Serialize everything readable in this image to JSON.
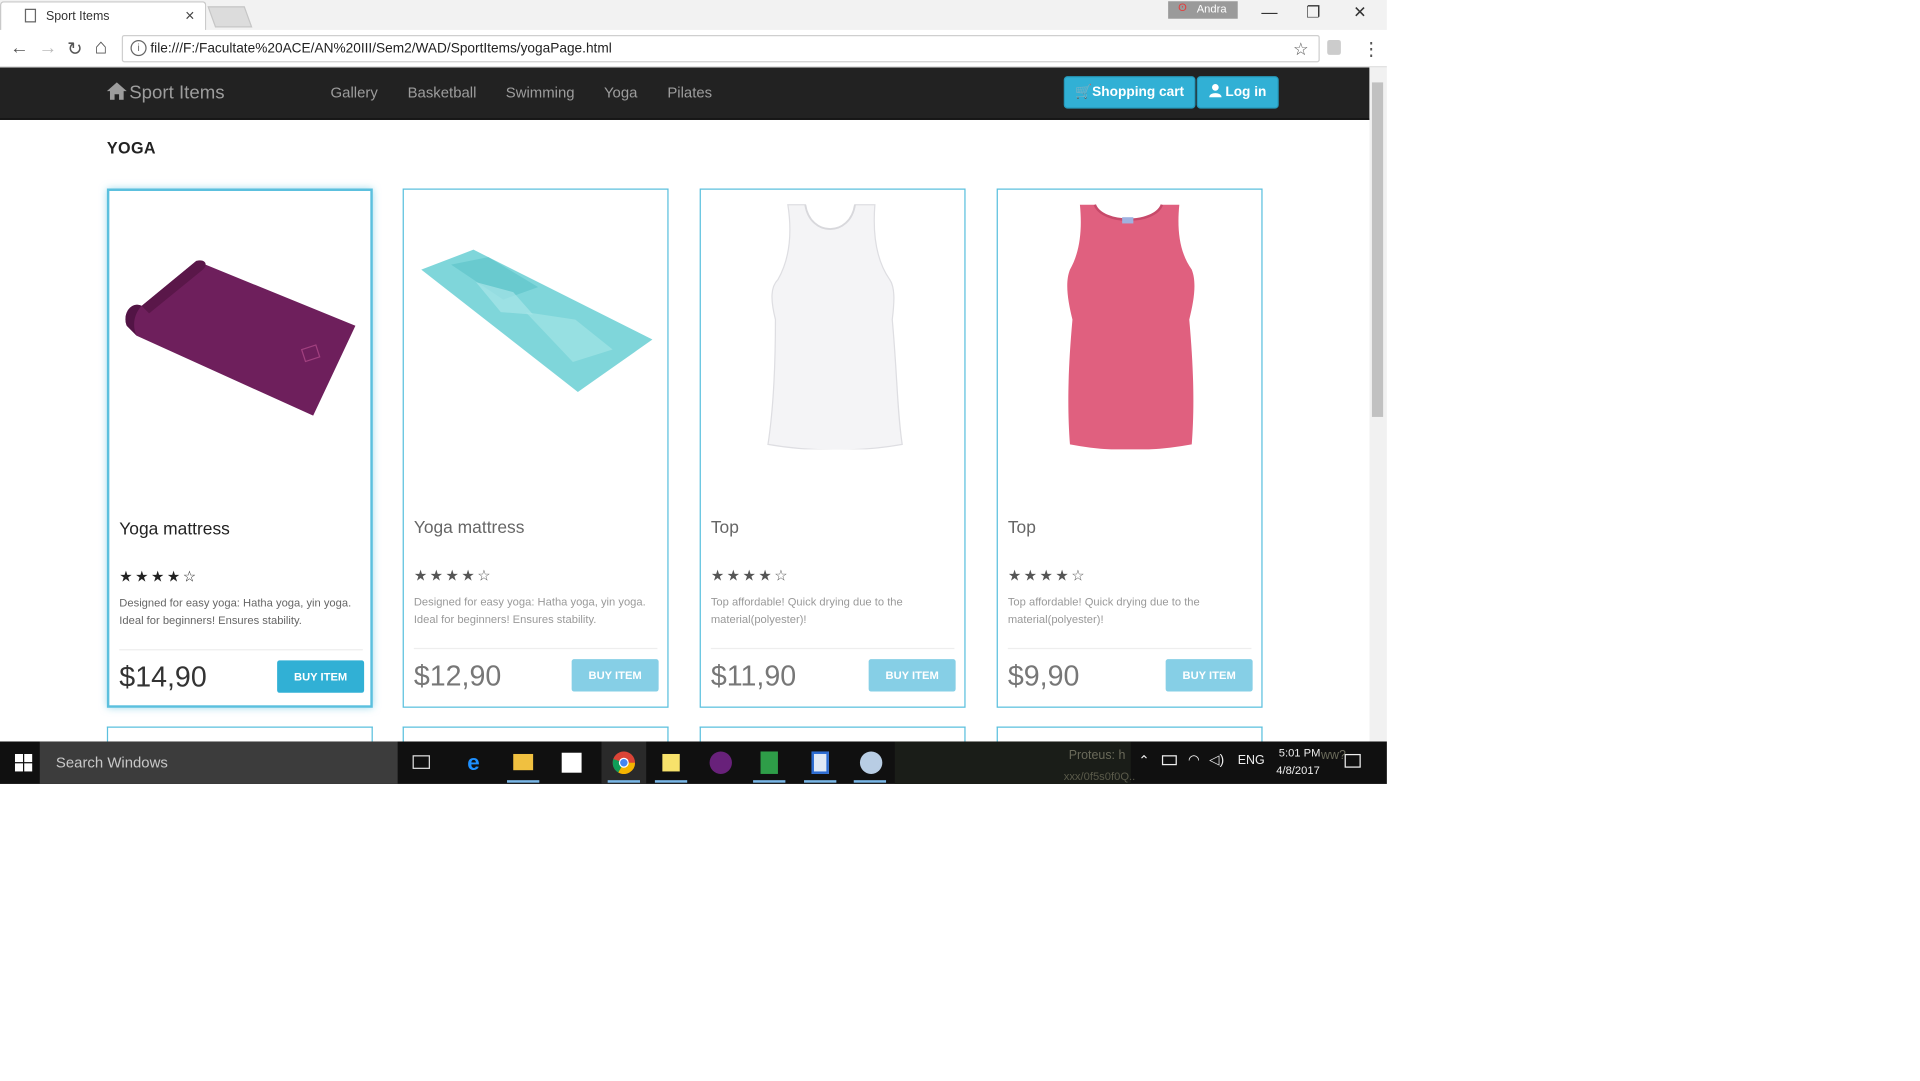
{
  "browser": {
    "tab_title": "Sport Items",
    "tab_close": "×",
    "profile_name": "Andra",
    "url": "file:///F:/Facultate%20ACE/AN%20III/Sem2/WAD/SportItems/yogaPage.html",
    "info_icon": "i",
    "window_controls": {
      "minimize": "—",
      "restore": "❐",
      "close": "✕"
    },
    "nav_icons": {
      "back": "←",
      "forward": "→",
      "reload": "↻",
      "home": "⌂",
      "bookmark": "☆",
      "menu": "⋮"
    }
  },
  "navbar": {
    "brand": "Sport Items",
    "links": [
      "Gallery",
      "Basketball",
      "Swimming",
      "Yoga",
      "Pilates"
    ],
    "cart_label": "Shopping cart",
    "login_label": "Log in",
    "accent_color": "#5bc0de"
  },
  "page": {
    "heading": "YOGA",
    "products": [
      {
        "name": "Yoga mattress",
        "stars": "★★★★☆",
        "rating": 4,
        "description": "Designed for easy yoga: Hatha yoga, yin yoga. Ideal for beginners! Ensures stability.",
        "price": "$14,90",
        "button": "BUY ITEM",
        "image_color": "#6e1f5c"
      },
      {
        "name": "Yoga mattress",
        "stars": "★★★★☆",
        "rating": 4,
        "description": "Designed for easy yoga: Hatha yoga, yin yoga. Ideal for beginners! Ensures stability.",
        "price": "$12,90",
        "button": "BUY ITEM",
        "image_color": "#6fd0d4"
      },
      {
        "name": "Top",
        "stars": "★★★★☆",
        "rating": 4,
        "description": "Top affordable! Quick drying due to the material(polyester)!",
        "price": "$11,90",
        "button": "BUY ITEM",
        "image_color": "#f4f4f6"
      },
      {
        "name": "Top",
        "stars": "★★★★☆",
        "rating": 4,
        "description": "Top affordable! Quick drying due to the material(polyester)!",
        "price": "$9,90",
        "button": "BUY ITEM",
        "image_color": "#e0607f"
      }
    ]
  },
  "taskbar": {
    "search_placeholder": "Search Windows",
    "language": "ENG",
    "time": "5:01 PM",
    "date": "4/8/2017",
    "notification_text": "Proteus: h",
    "notification_text_2": "ww?",
    "notification_sub": "xxx/0f5s0f0Q.."
  }
}
